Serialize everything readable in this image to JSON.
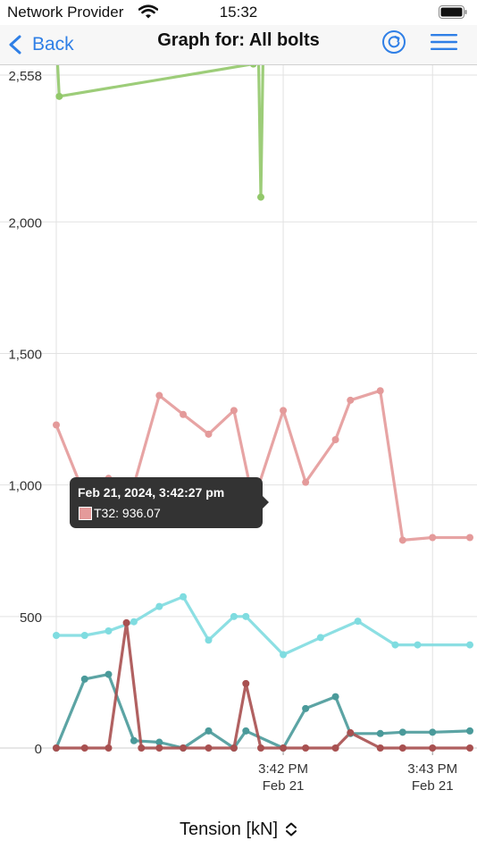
{
  "status_bar": {
    "carrier": "Network Provider",
    "time": "15:32"
  },
  "nav": {
    "back_label": "Back",
    "title": "Graph for: All bolts",
    "refresh_icon": "refresh-icon",
    "menu_icon": "hamburger-menu-icon"
  },
  "colors": {
    "accent": "#2f7fe6",
    "tooltip_bg": "#333333"
  },
  "tooltip": {
    "title": "Feb 21, 2024, 3:42:27 pm",
    "series_label": "T32: 936.07"
  },
  "metric_selector": {
    "label": "Tension [kN]",
    "icon": "up-down-chevron-icon"
  },
  "chart_data": {
    "type": "line",
    "title": "",
    "xlabel": "",
    "ylabel": "",
    "ylim": [
      0,
      2558
    ],
    "xlim_minutes": [
      -1.52,
      1.25
    ],
    "y_ticks": [
      0,
      500,
      1000,
      1500,
      2000,
      2558
    ],
    "y_tick_labels": [
      "0",
      "500",
      "1,000",
      "1,500",
      "2,000",
      "2,558"
    ],
    "x_ticks": [
      0,
      1
    ],
    "x_tick_labels": [
      [
        "3:42 PM",
        "Feb 21"
      ],
      [
        "3:43 PM",
        "Feb 21"
      ]
    ],
    "grid": true,
    "series": [
      {
        "color": "#92c86a",
        "x": [
          -1.52,
          -1.5,
          -0.2,
          -0.17,
          -0.15,
          -0.13,
          -0.1
        ],
        "y": [
          2700,
          2477,
          2600,
          2800,
          2094,
          2800,
          2700
        ]
      },
      {
        "color": "#e49a9a",
        "x": [
          -1.52,
          -1.33,
          -1.17,
          -1.0,
          -0.83,
          -0.67,
          -0.5,
          -0.33,
          -0.2,
          -0.0,
          0.15,
          0.35,
          0.45,
          0.65,
          0.8,
          1.0,
          1.25
        ],
        "y": [
          1228,
          960,
          1025,
          1000,
          1340,
          1268,
          1193,
          1283,
          936,
          1283,
          1010,
          1172,
          1322,
          1358,
          790,
          800,
          800
        ]
      },
      {
        "color": "#7fdce0",
        "x": [
          -1.52,
          -1.33,
          -1.17,
          -1.0,
          -0.83,
          -0.67,
          -0.5,
          -0.33,
          -0.25,
          0.0,
          0.25,
          0.5,
          0.75,
          0.9,
          1.25
        ],
        "y": [
          428,
          428,
          445,
          480,
          538,
          575,
          410,
          500,
          500,
          355,
          420,
          482,
          392,
          392,
          392
        ]
      },
      {
        "color": "#4a9a9a",
        "x": [
          -1.52,
          -1.33,
          -1.17,
          -1.0,
          -0.83,
          -0.67,
          -0.5,
          -0.33,
          -0.25,
          0.0,
          0.15,
          0.35,
          0.45,
          0.65,
          0.8,
          1.0,
          1.25
        ],
        "y": [
          0,
          262,
          280,
          28,
          22,
          0,
          65,
          0,
          65,
          0,
          150,
          195,
          55,
          55,
          60,
          60,
          65
        ]
      },
      {
        "color": "#a85050",
        "x": [
          -1.52,
          -1.33,
          -1.17,
          -1.05,
          -0.95,
          -0.83,
          -0.67,
          -0.5,
          -0.33,
          -0.25,
          -0.15,
          0.0,
          0.15,
          0.35,
          0.45,
          0.65,
          0.8,
          1.0,
          1.25
        ],
        "y": [
          0,
          0,
          0,
          476,
          0,
          0,
          0,
          0,
          0,
          245,
          0,
          0,
          0,
          0,
          58,
          0,
          0,
          0,
          0
        ]
      }
    ]
  }
}
